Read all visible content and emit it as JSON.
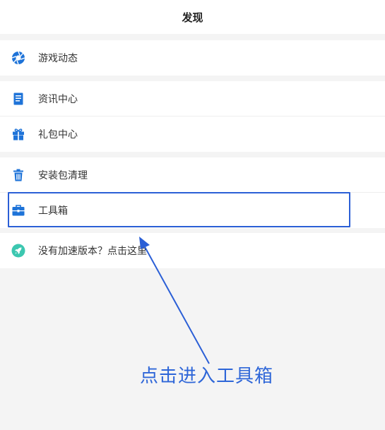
{
  "header": {
    "title": "发现"
  },
  "groups": {
    "g1": {
      "items": [
        {
          "label": "游戏动态",
          "icon": "aperture-icon"
        }
      ]
    },
    "g2": {
      "items": [
        {
          "label": "资讯中心",
          "icon": "document-icon"
        },
        {
          "label": "礼包中心",
          "icon": "gift-icon"
        }
      ]
    },
    "g3": {
      "items": [
        {
          "label": "安装包清理",
          "icon": "trash-icon"
        },
        {
          "label": "工具箱",
          "icon": "toolbox-icon"
        }
      ]
    },
    "g4": {
      "items": [
        {
          "label": "没有加速版本？点击这里",
          "icon": "rocket-icon"
        }
      ]
    }
  },
  "annotation": {
    "text": "点击进入工具箱"
  },
  "colors": {
    "accent": "#1e73d8",
    "rocket_badge": "#3cc7b0",
    "annotation": "#2e66d8",
    "page_bg": "#f4f4f4"
  }
}
